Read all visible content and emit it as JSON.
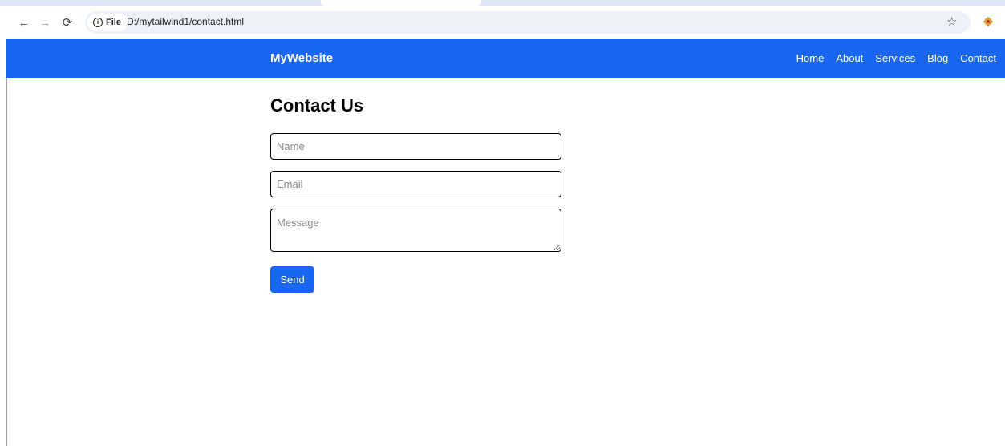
{
  "browser": {
    "chip_label": "File",
    "url": "D:/mytailwind1/contact.html"
  },
  "site": {
    "brand": "MyWebsite",
    "nav": [
      "Home",
      "About",
      "Services",
      "Blog",
      "Contact"
    ]
  },
  "page": {
    "title": "Contact Us",
    "name_placeholder": "Name",
    "email_placeholder": "Email",
    "message_placeholder": "Message",
    "send_label": "Send"
  },
  "colors": {
    "brand_blue": "#1866f2"
  }
}
